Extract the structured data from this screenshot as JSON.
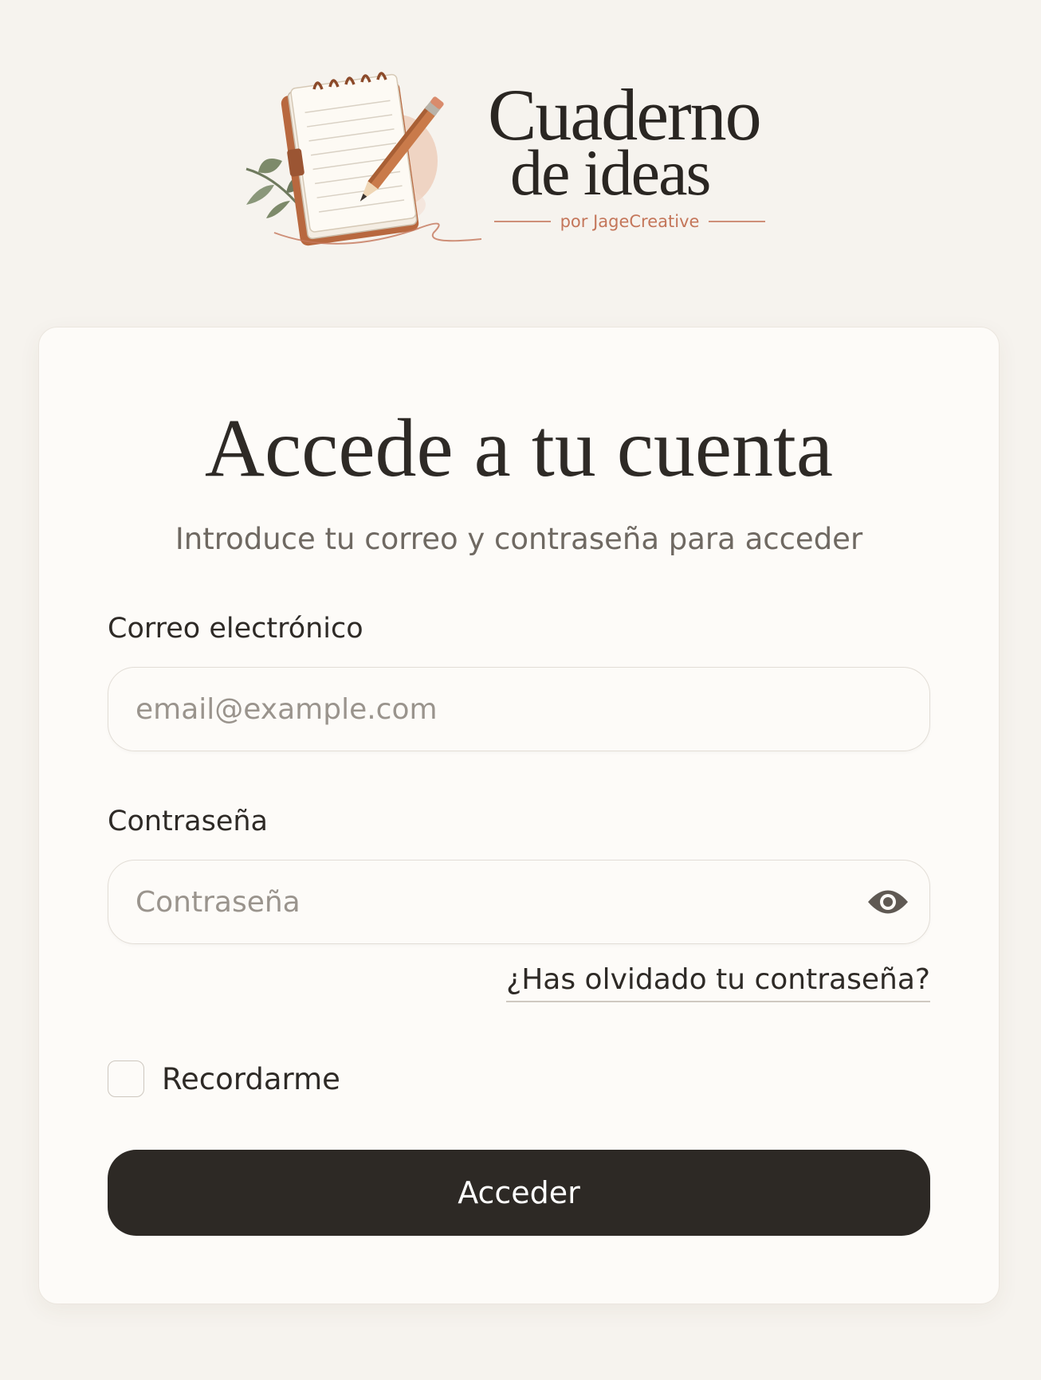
{
  "brand": {
    "name_line1": "Cuaderno",
    "name_line2": "de ideas",
    "byline": "por JageCreative"
  },
  "login": {
    "title": "Accede a tu cuenta",
    "subtitle": "Introduce tu correo y contraseña para acceder",
    "email": {
      "label": "Correo electrónico",
      "placeholder": "email@example.com",
      "value": ""
    },
    "password": {
      "label": "Contraseña",
      "placeholder": "Contraseña",
      "value": ""
    },
    "forgot_link": "¿Has olvidado tu contraseña?",
    "remember_label": "Recordarme",
    "remember_checked": false,
    "submit_label": "Acceder"
  },
  "icons": {
    "logo": "notebook-pencil-icon",
    "password_toggle": "eye-icon"
  },
  "colors": {
    "background": "#f6f3ee",
    "card": "#fdfbf8",
    "primary_button": "#2d2925",
    "accent": "#c4765a"
  }
}
